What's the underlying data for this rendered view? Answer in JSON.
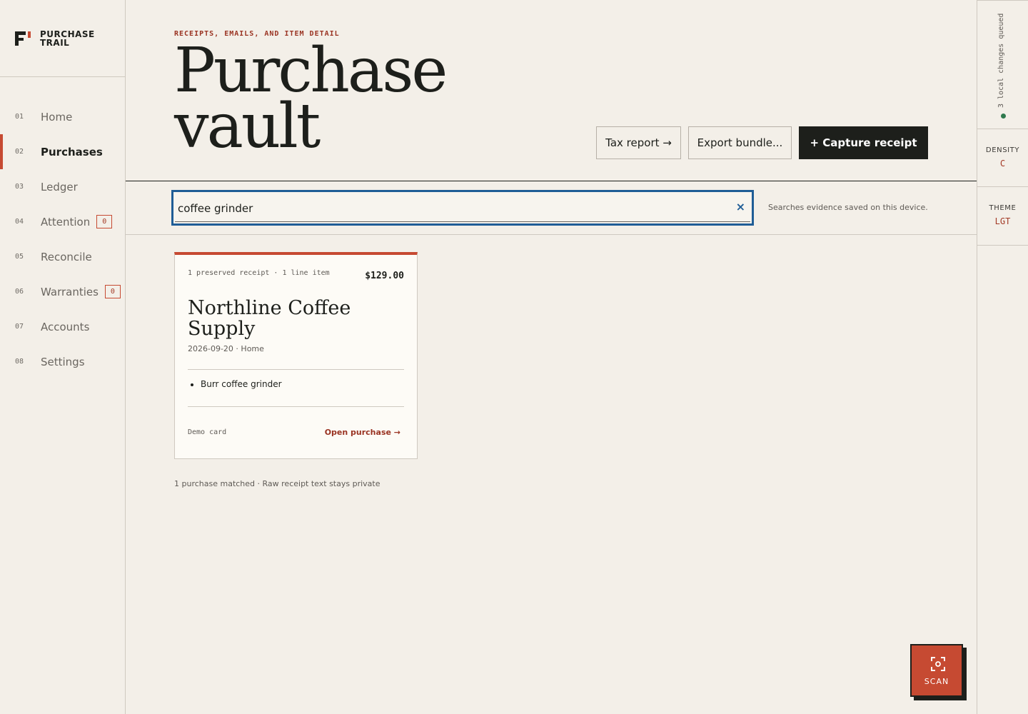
{
  "brand": {
    "line1": "PURCHASE",
    "line2": "TRAIL"
  },
  "nav": [
    {
      "num": "01",
      "label": "Home"
    },
    {
      "num": "02",
      "label": "Purchases",
      "active": true
    },
    {
      "num": "03",
      "label": "Ledger"
    },
    {
      "num": "04",
      "label": "Attention",
      "badge": "0"
    },
    {
      "num": "05",
      "label": "Reconcile"
    },
    {
      "num": "06",
      "label": "Warranties",
      "badge": "0"
    },
    {
      "num": "07",
      "label": "Accounts"
    },
    {
      "num": "08",
      "label": "Settings"
    }
  ],
  "header": {
    "eyebrow": "RECEIPTS, EMAILS, AND ITEM DETAIL",
    "title_line1": "Purchase",
    "title_line2": "vault",
    "tax_report": "Tax report →",
    "export_bundle": "Export bundle...",
    "capture_receipt": "+ Capture receipt"
  },
  "search": {
    "value": "coffee grinder",
    "clear": "×",
    "hint": "Searches evidence saved on this device."
  },
  "card": {
    "meta": "1 preserved receipt · 1 line item",
    "price": "$129.00",
    "merchant": "Northline Coffee Supply",
    "subline": "2026-09-20 · Home",
    "items": [
      "Burr coffee grinder"
    ],
    "payment": "Demo card",
    "open_link": "Open purchase →"
  },
  "summary": "1 purchase matched · Raw receipt text stays private",
  "rail": {
    "queue": "3 local changes queued",
    "density_label": "DENSITY",
    "density_value": "C",
    "theme_label": "THEME",
    "theme_value": "LGT"
  },
  "scan": {
    "label": "SCAN"
  },
  "colors": {
    "accent": "#c64a32",
    "focus": "#1f5d96",
    "ink": "#1d1f1b",
    "background": "#f3efe8",
    "status_ok": "#2f7a4e"
  }
}
